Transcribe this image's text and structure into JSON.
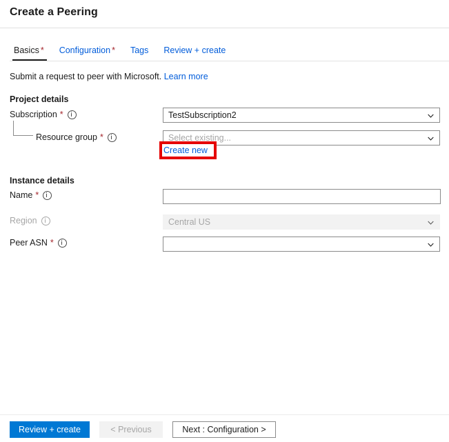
{
  "header": {
    "title": "Create a Peering"
  },
  "tabs": [
    {
      "label": "Basics",
      "required": "*",
      "active": true
    },
    {
      "label": "Configuration",
      "required": "*",
      "active": false
    },
    {
      "label": "Tags",
      "required": "",
      "active": false
    },
    {
      "label": "Review + create",
      "required": "",
      "active": false
    }
  ],
  "intro": {
    "text": "Submit a request to peer with Microsoft.",
    "link_label": "Learn more"
  },
  "sections": {
    "project_details": {
      "heading": "Project details",
      "subscription": {
        "label": "Subscription",
        "required": "*",
        "value": "TestSubscription2"
      },
      "resource_group": {
        "label": "Resource group",
        "required": "*",
        "placeholder": "Select existing...",
        "create_new_label": "Create new"
      }
    },
    "instance_details": {
      "heading": "Instance details",
      "name": {
        "label": "Name",
        "required": "*",
        "value": ""
      },
      "region": {
        "label": "Region",
        "required": "",
        "value": "Central US",
        "disabled": true
      },
      "peer_asn": {
        "label": "Peer ASN",
        "required": "*",
        "value": ""
      }
    }
  },
  "footer": {
    "review_create_label": "Review + create",
    "previous_label": "< Previous",
    "next_label": "Next : Configuration >"
  },
  "colors": {
    "accent": "#0078d4",
    "link": "#015cda",
    "required_asterisk": "#a4262c",
    "annotation": "#e50000",
    "disabled_bg": "#f2f2f2",
    "disabled_text": "#a6a6a6"
  }
}
